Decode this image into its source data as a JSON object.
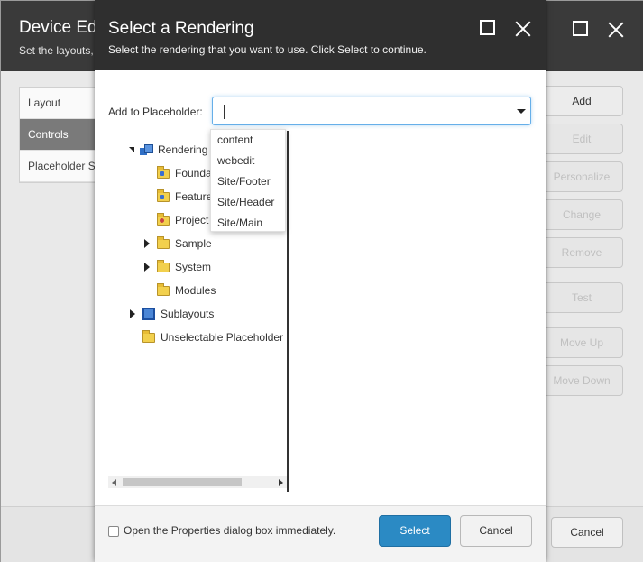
{
  "background_dialog": {
    "title": "Device Edi",
    "subtitle": "Set the layouts,",
    "tabs": [
      {
        "label": "Layout",
        "active": false
      },
      {
        "label": "Controls",
        "active": true
      },
      {
        "label": "Placeholder S",
        "active": false
      }
    ],
    "buttons": [
      {
        "label": "Add",
        "enabled": true
      },
      {
        "label": "Edit",
        "enabled": false
      },
      {
        "label": "Personalize",
        "enabled": false
      },
      {
        "label": "Change",
        "enabled": false
      },
      {
        "label": "Remove",
        "enabled": false
      },
      {
        "label": "Test",
        "enabled": false
      },
      {
        "label": "Move Up",
        "enabled": false
      },
      {
        "label": "Move Down",
        "enabled": false
      }
    ],
    "cancel_label": "Cancel"
  },
  "modal": {
    "title": "Select a Rendering",
    "subtitle": "Select the rendering that you want to use. Click Select to continue.",
    "placeholder_label": "Add to Placeholder:",
    "placeholder_value": "",
    "dropdown_options": [
      "content",
      "webedit",
      "Site/Footer",
      "Site/Header",
      "Site/Main"
    ],
    "tree": [
      {
        "label": "Rendering",
        "icon": "rendering-icon",
        "expander": "open"
      },
      {
        "label": "Founda",
        "icon": "folder-badge-icon",
        "expander": "none"
      },
      {
        "label": "Feature",
        "icon": "folder-badge-icon",
        "expander": "none"
      },
      {
        "label": "Project",
        "icon": "folder-badge-icon",
        "expander": "none"
      },
      {
        "label": "Sample",
        "icon": "folder-icon",
        "expander": "closed"
      },
      {
        "label": "System",
        "icon": "folder-icon",
        "expander": "closed"
      },
      {
        "label": "Modules",
        "icon": "folder-icon",
        "expander": "none"
      },
      {
        "label": "Sublayouts",
        "icon": "sublayout-icon",
        "expander": "closed"
      },
      {
        "label": "Unselectable Placeholder",
        "icon": "folder-icon",
        "expander": "none"
      }
    ],
    "checkbox_label": "Open the Properties dialog box immediately.",
    "checkbox_checked": false,
    "select_label": "Select",
    "cancel_label": "Cancel"
  },
  "colors": {
    "header_bg": "#2f2f2f",
    "primary_button": "#2b8ac4",
    "focus_border": "#66afe9"
  }
}
